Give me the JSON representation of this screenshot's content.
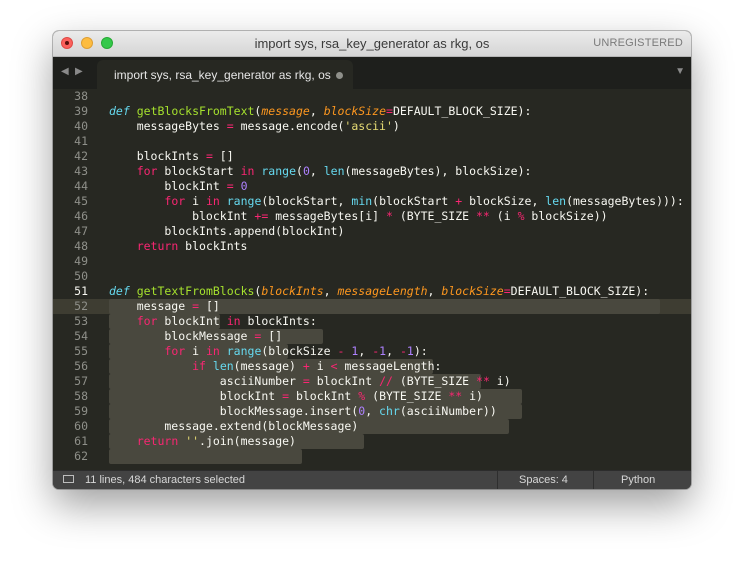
{
  "window": {
    "title": "import sys, rsa_key_generator as rkg, os",
    "registration": "UNREGISTERED"
  },
  "tabs": [
    {
      "label": "import sys, rsa_key_generator as rkg, os",
      "dirty": true
    }
  ],
  "editor": {
    "current_line": 51,
    "lines": [
      {
        "num": "38",
        "text": ""
      },
      {
        "num": "39",
        "text": "def getBlocksFromText(message, blockSize=DEFAULT_BLOCK_SIZE):"
      },
      {
        "num": "40",
        "text": "    messageBytes = message.encode('ascii')"
      },
      {
        "num": "41",
        "text": ""
      },
      {
        "num": "42",
        "text": "    blockInts = []"
      },
      {
        "num": "43",
        "text": "    for blockStart in range(0, len(messageBytes), blockSize):"
      },
      {
        "num": "44",
        "text": "        blockInt = 0"
      },
      {
        "num": "45",
        "text": "        for i in range(blockStart, min(blockStart + blockSize, len(messageBytes))):"
      },
      {
        "num": "46",
        "text": "            blockInt += messageBytes[i] * (BYTE_SIZE ** (i % blockSize))"
      },
      {
        "num": "47",
        "text": "        blockInts.append(blockInt)"
      },
      {
        "num": "48",
        "text": "    return blockInts"
      },
      {
        "num": "49",
        "text": ""
      },
      {
        "num": "50",
        "text": ""
      },
      {
        "num": "51",
        "text": "def getTextFromBlocks(blockInts, messageLength, blockSize=DEFAULT_BLOCK_SIZE):"
      },
      {
        "num": "52",
        "text": "    message = []"
      },
      {
        "num": "53",
        "text": "    for blockInt in blockInts:"
      },
      {
        "num": "54",
        "text": "        blockMessage = []"
      },
      {
        "num": "55",
        "text": "        for i in range(blockSize - 1, -1, -1):"
      },
      {
        "num": "56",
        "text": "            if len(message) + i < messageLength:"
      },
      {
        "num": "57",
        "text": "                asciiNumber = blockInt // (BYTE_SIZE ** i)"
      },
      {
        "num": "58",
        "text": "                blockInt = blockInt % (BYTE_SIZE ** i)"
      },
      {
        "num": "59",
        "text": "                blockMessage.insert(0, chr(asciiNumber))"
      },
      {
        "num": "60",
        "text": "        message.extend(blockMessage)"
      },
      {
        "num": "61",
        "text": "    return ''.join(message)"
      },
      {
        "num": "62",
        "text": ""
      }
    ]
  },
  "statusbar": {
    "selection": "11 lines, 484 characters selected",
    "indentation": "Spaces: 4",
    "syntax": "Python"
  },
  "colors": {
    "background": "#272822",
    "selection": "#49483e",
    "keyword": "#f92672",
    "function": "#a6e22e",
    "parameter": "#fd971f",
    "string": "#e6db74",
    "number": "#ae81ff",
    "builtin": "#66d9ef"
  }
}
